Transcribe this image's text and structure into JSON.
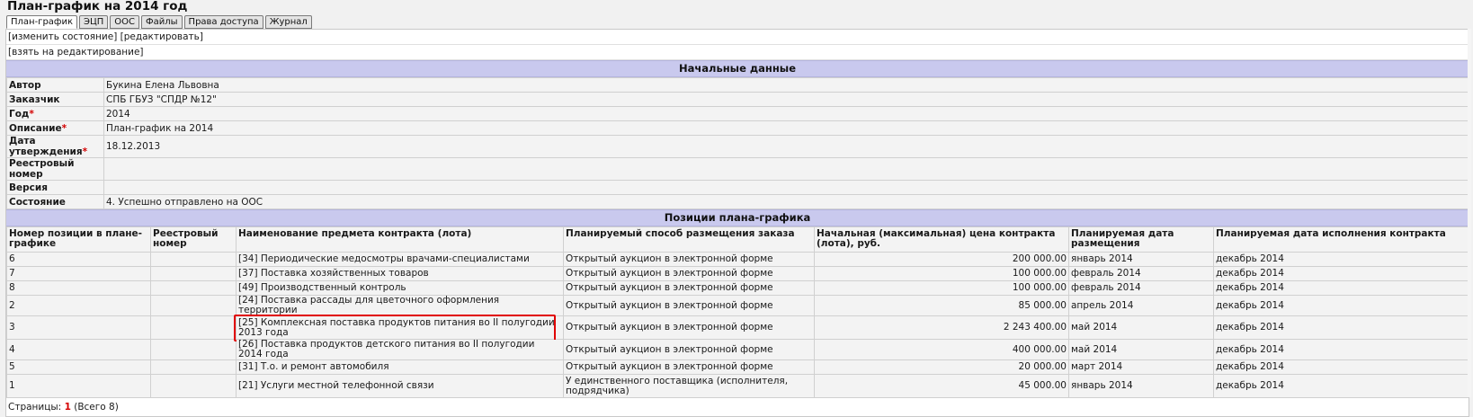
{
  "page": {
    "title": "План-график на 2014 год"
  },
  "tabs": [
    {
      "label": "План-график",
      "active": true
    },
    {
      "label": "ЭЦП"
    },
    {
      "label": "ООС"
    },
    {
      "label": "Файлы"
    },
    {
      "label": "Права доступа"
    },
    {
      "label": "Журнал"
    }
  ],
  "actions": {
    "change_state": "[изменить состояние]",
    "edit": "[редактировать]",
    "take_for_edit": "[взять на редактирование]"
  },
  "initial_data": {
    "header": "Начальные данные",
    "fields": [
      {
        "label": "Автор",
        "required": false,
        "value": "Букина Елена Львовна"
      },
      {
        "label": "Заказчик",
        "required": false,
        "value": "СПБ ГБУЗ \"СПДР №12\""
      },
      {
        "label": "Год",
        "required": true,
        "value": "2014"
      },
      {
        "label": "Описание",
        "required": true,
        "value": "План-график на 2014"
      },
      {
        "label": "Дата утверждения",
        "required": true,
        "value": "18.12.2013"
      },
      {
        "label": "Реестровый номер",
        "required": false,
        "value": ""
      },
      {
        "label": "Версия",
        "required": false,
        "value": ""
      },
      {
        "label": "Состояние",
        "required": false,
        "value": "4. Успешно отправлено на ООС"
      }
    ]
  },
  "positions": {
    "header": "Позиции плана-графика",
    "columns": [
      "Номер позиции в плане-графике",
      "Реестровый номер",
      "Наименование предмета контракта (лота)",
      "Планируемый способ размещения заказа",
      "Начальная (максимальная) цена контракта (лота), руб.",
      "Планируемая дата размещения",
      "Планируемая дата исполнения контракта"
    ],
    "rows": [
      {
        "num": "6",
        "reg": "",
        "name": "[34] Периодические медосмотры врачами-специалистами",
        "method": "Открытый аукцион в электронной форме",
        "price": "200 000.00",
        "placement": "январь 2014",
        "execution": "декабрь 2014"
      },
      {
        "num": "7",
        "reg": "",
        "name": "[37] Поставка хозяйственных товаров",
        "method": "Открытый аукцион в электронной форме",
        "price": "100 000.00",
        "placement": "февраль 2014",
        "execution": "декабрь 2014"
      },
      {
        "num": "8",
        "reg": "",
        "name": "[49] Производственный контроль",
        "method": "Открытый аукцион в электронной форме",
        "price": "100 000.00",
        "placement": "февраль 2014",
        "execution": "декабрь 2014"
      },
      {
        "num": "2",
        "reg": "",
        "name": "[24] Поставка рассады для цветочного оформления территории",
        "method": "Открытый аукцион в электронной форме",
        "price": "85 000.00",
        "placement": "апрель 2014",
        "execution": "декабрь 2014"
      },
      {
        "num": "3",
        "reg": "",
        "name": "[25] Комплексная поставка продуктов питания во II полугодии 2013 года",
        "method": "Открытый аукцион в электронной форме",
        "price": "2 243 400.00",
        "placement": "май 2014",
        "execution": "декабрь 2014",
        "highlighted": true
      },
      {
        "num": "4",
        "reg": "",
        "name": "[26] Поставка продуктов детского питания во II полугодии 2014 года",
        "method": "Открытый аукцион в электронной форме",
        "price": "400 000.00",
        "placement": "май 2014",
        "execution": "декабрь 2014"
      },
      {
        "num": "5",
        "reg": "",
        "name": "[31] Т.о. и ремонт автомобиля",
        "method": "Открытый аукцион в электронной форме",
        "price": "20 000.00",
        "placement": "март 2014",
        "execution": "декабрь 2014"
      },
      {
        "num": "1",
        "reg": "",
        "name": "[21] Услуги местной телефонной связи",
        "method": "У единственного поставщика (исполнителя, подрядчика)",
        "price": "45 000.00",
        "placement": "январь 2014",
        "execution": "декабрь 2014"
      }
    ]
  },
  "pager": {
    "label": "Страницы:",
    "current": "1",
    "total": "(Всего 8)"
  }
}
